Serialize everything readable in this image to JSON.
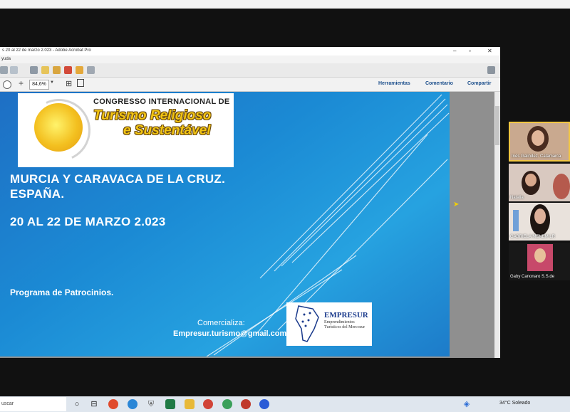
{
  "window": {
    "title": "s 20 al 22 de marzo 2.023 - Adobe Acrobat Pro",
    "menu_fragment": "yuda",
    "zoom": "84,6%",
    "right_links": [
      "Herramientas",
      "Comentario",
      "Compartir"
    ]
  },
  "slide": {
    "logo": {
      "line1": "CONGRESSO INTERNACIONAL DE",
      "line2": "Turismo Religioso",
      "line3": "e Sustentável"
    },
    "heading_line1": "MURCIA Y CARAVACA DE LA CRUZ.",
    "heading_line2": "ESPAÑA.",
    "dates": "20 AL 22 DE MARZO 2.023",
    "program": "Programa de Patrocinios.",
    "comercializa": "Comercializa:",
    "email": "Empresur.turismo@gmail.com",
    "partner_logo": {
      "title": "EMPRESUR",
      "subtitle": "Emprendimientos Turísticos del Mercosur"
    }
  },
  "participants": [
    {
      "name": "Inés Galindez. Catamarca"
    },
    {
      "name": "Natalia"
    },
    {
      "name": "GABRIELA MENEM LR"
    },
    {
      "name": "Gaby Canonaro S.S.de"
    }
  ],
  "taskbar": {
    "search_placeholder": "uscar",
    "weather": "34°C  Soleado"
  },
  "colors": {
    "slide_blue": "#1b8ad4",
    "logo_gold": "#f2c413",
    "link_blue": "#1c4f8c"
  }
}
